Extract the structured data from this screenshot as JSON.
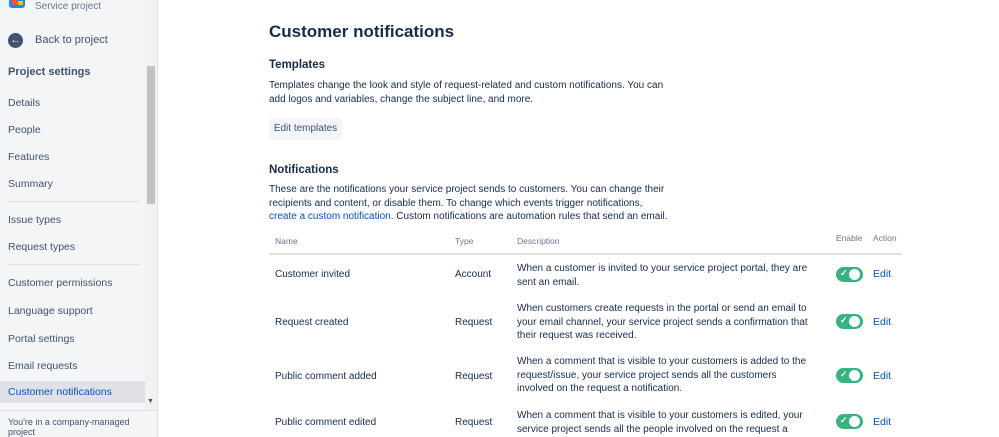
{
  "sidebar": {
    "project_type": "Service project",
    "back_label": "Back to project",
    "settings_title": "Project settings",
    "items": [
      {
        "label": "Details"
      },
      {
        "label": "People"
      },
      {
        "label": "Features"
      },
      {
        "label": "Summary"
      },
      {
        "label": "Issue types"
      },
      {
        "label": "Request types"
      },
      {
        "label": "Customer permissions"
      },
      {
        "label": "Language support"
      },
      {
        "label": "Portal settings"
      },
      {
        "label": "Email requests"
      },
      {
        "label": "Customer notifications"
      }
    ],
    "footer": "You're in a company-managed project"
  },
  "main": {
    "title": "Customer notifications",
    "templates": {
      "heading": "Templates",
      "description": "Templates change the look and style of request-related and custom notifications. You can add logos and variables, change the subject line, and more.",
      "button": "Edit templates"
    },
    "notifications": {
      "heading": "Notifications",
      "description_pre": "These are the notifications your service project sends to customers. You can change their recipients and content, or disable them. To change which events trigger notifications, ",
      "description_link": "create a custom notification",
      "description_post": ". Custom notifications are automation rules that send an email.",
      "columns": {
        "name": "Name",
        "type": "Type",
        "description": "Description",
        "enable": "Enable",
        "action": "Action"
      },
      "rows": [
        {
          "name": "Customer invited",
          "type": "Account",
          "description": "When a customer is invited to your service project portal, they are sent an email.",
          "enabled": true,
          "action": "Edit"
        },
        {
          "name": "Request created",
          "type": "Request",
          "description": "When customers create requests in the portal or send an email to your email channel, your service project sends a confirmation that their request was received.",
          "enabled": true,
          "action": "Edit"
        },
        {
          "name": "Public comment added",
          "type": "Request",
          "description": "When a comment that is visible to your customers is added to the request/issue, your service project sends all the customers involved on the request a notification.",
          "enabled": true,
          "action": "Edit"
        },
        {
          "name": "Public comment edited",
          "type": "Request",
          "description": "When a comment that is visible to your customers is edited, your service project sends all the people involved on the request a notification.",
          "enabled": true,
          "action": "Edit"
        }
      ]
    }
  },
  "colors": {
    "accent": "#0052cc",
    "toggle_on": "#36b37e",
    "sidebar_bg": "#f4f5f7"
  }
}
